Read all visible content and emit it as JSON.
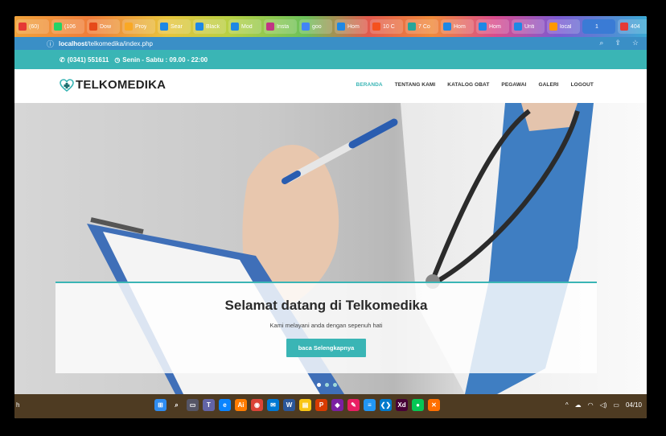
{
  "browser": {
    "tabs": [
      {
        "label": "(60)",
        "color": "#e53935"
      },
      {
        "label": "(106",
        "color": "#25d366"
      },
      {
        "label": "Dow",
        "color": "#e64a19"
      },
      {
        "label": "Proy",
        "color": "#f9a825"
      },
      {
        "label": "Sear",
        "color": "#1e88e5"
      },
      {
        "label": "Black",
        "color": "#1e88e5"
      },
      {
        "label": "Mod",
        "color": "#1e88e5"
      },
      {
        "label": "Insta",
        "color": "#c13584"
      },
      {
        "label": "goo",
        "color": "#4285f4"
      },
      {
        "label": "Hom",
        "color": "#1e88e5"
      },
      {
        "label": "10 C",
        "color": "#f4511e"
      },
      {
        "label": "7 Co",
        "color": "#26a69a"
      },
      {
        "label": "Hom",
        "color": "#1e88e5"
      },
      {
        "label": "Hom",
        "color": "#1e88e5"
      },
      {
        "label": "Unti",
        "color": "#1e88e5"
      },
      {
        "label": "local",
        "color": "#ff9800"
      },
      {
        "label": "1",
        "color": "#3a7bd5"
      },
      {
        "label": "404",
        "color": "#e53935"
      }
    ],
    "new_tab_symbol": "+",
    "url_host": "localhost",
    "url_path": "/telkomedika/index.php",
    "info_icon": "info-icon"
  },
  "topbar": {
    "phone": "(0341) 551611",
    "hours": "Senin - Sabtu : 09.00 - 22:00"
  },
  "brand": {
    "name": "TELKOMEDIKA",
    "accent": "#3ab5b5"
  },
  "nav": {
    "items": [
      "BERANDA",
      "TENTANG KAMI",
      "KATALOG OBAT",
      "PEGAWAI",
      "GALERI",
      "LOGOUT"
    ],
    "active": "BERANDA"
  },
  "hero": {
    "title": "Selamat datang di Telkomedika",
    "subtitle": "Kami melayani anda dengan sepenuh hati",
    "button": "baca Selengkapnya"
  },
  "taskbar": {
    "tray_time": "04/10",
    "left_char": "h"
  }
}
